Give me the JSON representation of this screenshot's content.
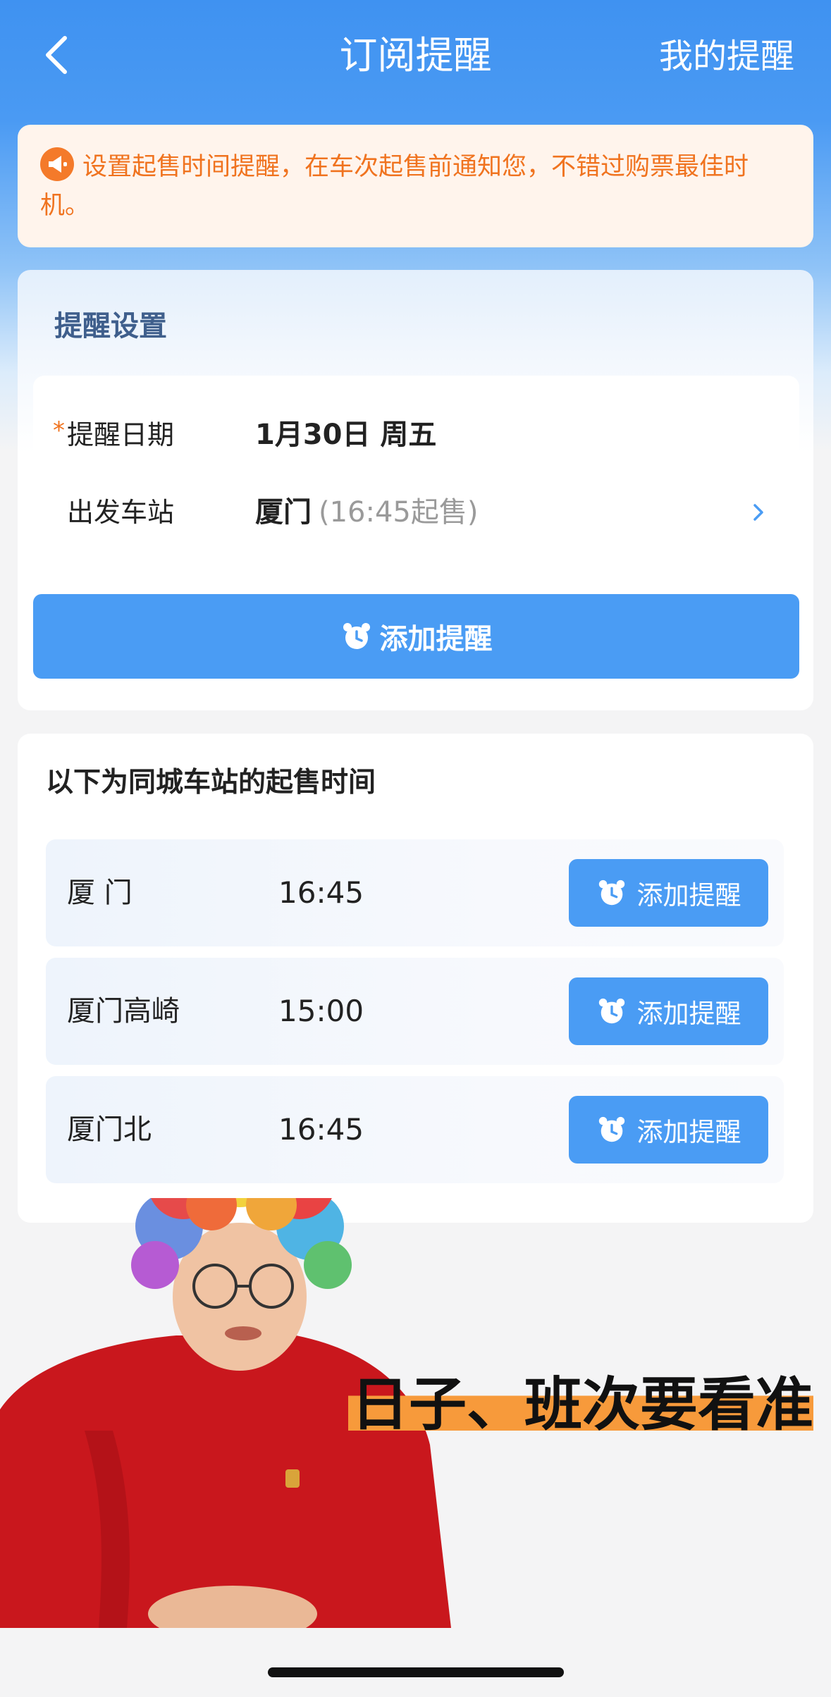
{
  "nav": {
    "title": "订阅提醒",
    "right": "我的提醒"
  },
  "notice": {
    "text": "设置起售时间提醒，在车次起售前通知您，不错过购票最佳时机。"
  },
  "settings": {
    "title": "提醒设置",
    "date_label": "提醒日期",
    "required_mark": "*",
    "date_value": "1月30日 周五",
    "station_label": "出发车站",
    "station_value": "厦门",
    "station_sub": "(16:45起售)",
    "add_button": "添加提醒"
  },
  "same_city": {
    "title": "以下为同城车站的起售时间",
    "stations": [
      {
        "name": "厦 门",
        "time": "16:45",
        "button": "添加提醒"
      },
      {
        "name": "厦门高崎",
        "time": "15:00",
        "button": "添加提醒"
      },
      {
        "name": "厦门北",
        "time": "16:45",
        "button": "添加提醒"
      }
    ]
  },
  "sticker": {
    "caption": "日子、班次要看准"
  },
  "colors": {
    "accent": "#4a9cf4",
    "notice_text": "#f0731f",
    "notice_bg": "#fff4ec"
  }
}
